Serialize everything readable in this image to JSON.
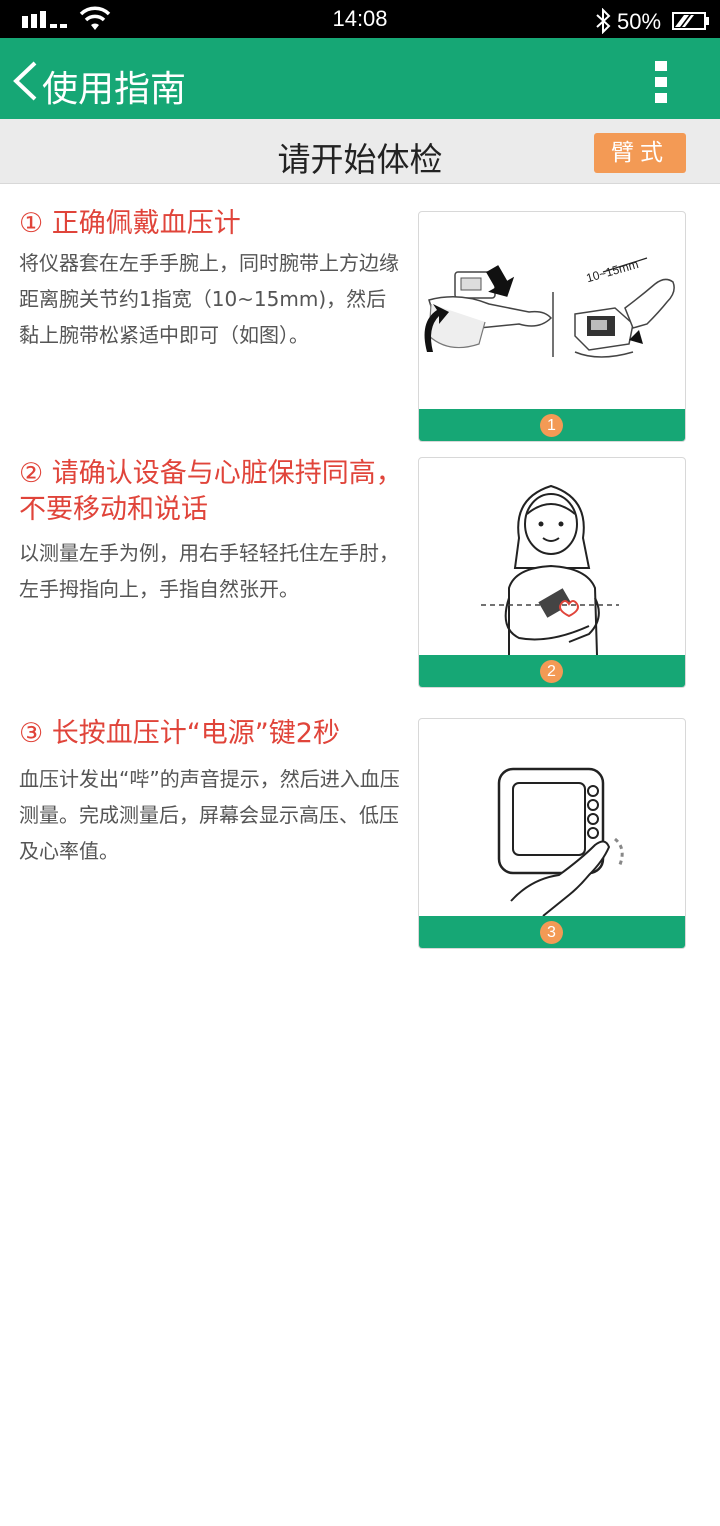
{
  "status_bar": {
    "time": "14:08",
    "battery_percent": "50%",
    "icons": [
      "signal-icon",
      "wifi-icon",
      "bluetooth-icon",
      "battery-icon"
    ]
  },
  "app_bar": {
    "back_icon": "chevron-left-icon",
    "title": "使用指南",
    "menu_icon": "more-vertical-icon"
  },
  "sub_header": {
    "title": "请开始体检",
    "mode_button": "臂式"
  },
  "steps": [
    {
      "heading": "① 正确佩戴血压计",
      "description": "将仪器套在左手手腕上，同时腕带上方边缘距离腕关节约1指宽（10~15mm)，然后黏上腕带松紧适中即可（如图）。",
      "image_icon": "wrist-cuff-illustration",
      "image_label": "10~15mm",
      "badge": "1"
    },
    {
      "heading": "② 请确认设备与心脏保持同高，不要移动和说话",
      "description": "以测量左手为例，用右手轻轻托住左手肘，左手拇指向上，手指自然张开。",
      "image_icon": "heart-level-posture-illustration",
      "badge": "2"
    },
    {
      "heading": "③ 长按血压计“电源”键2秒",
      "description": "血压计发出“哔”的声音提示，然后进入血压测量。完成测量后，屏幕会显示高压、低压及心率值。",
      "image_icon": "press-power-button-illustration",
      "badge": "3"
    }
  ],
  "colors": {
    "primary": "#16a775",
    "accent": "#f39a55",
    "heading": "#e0443a"
  }
}
